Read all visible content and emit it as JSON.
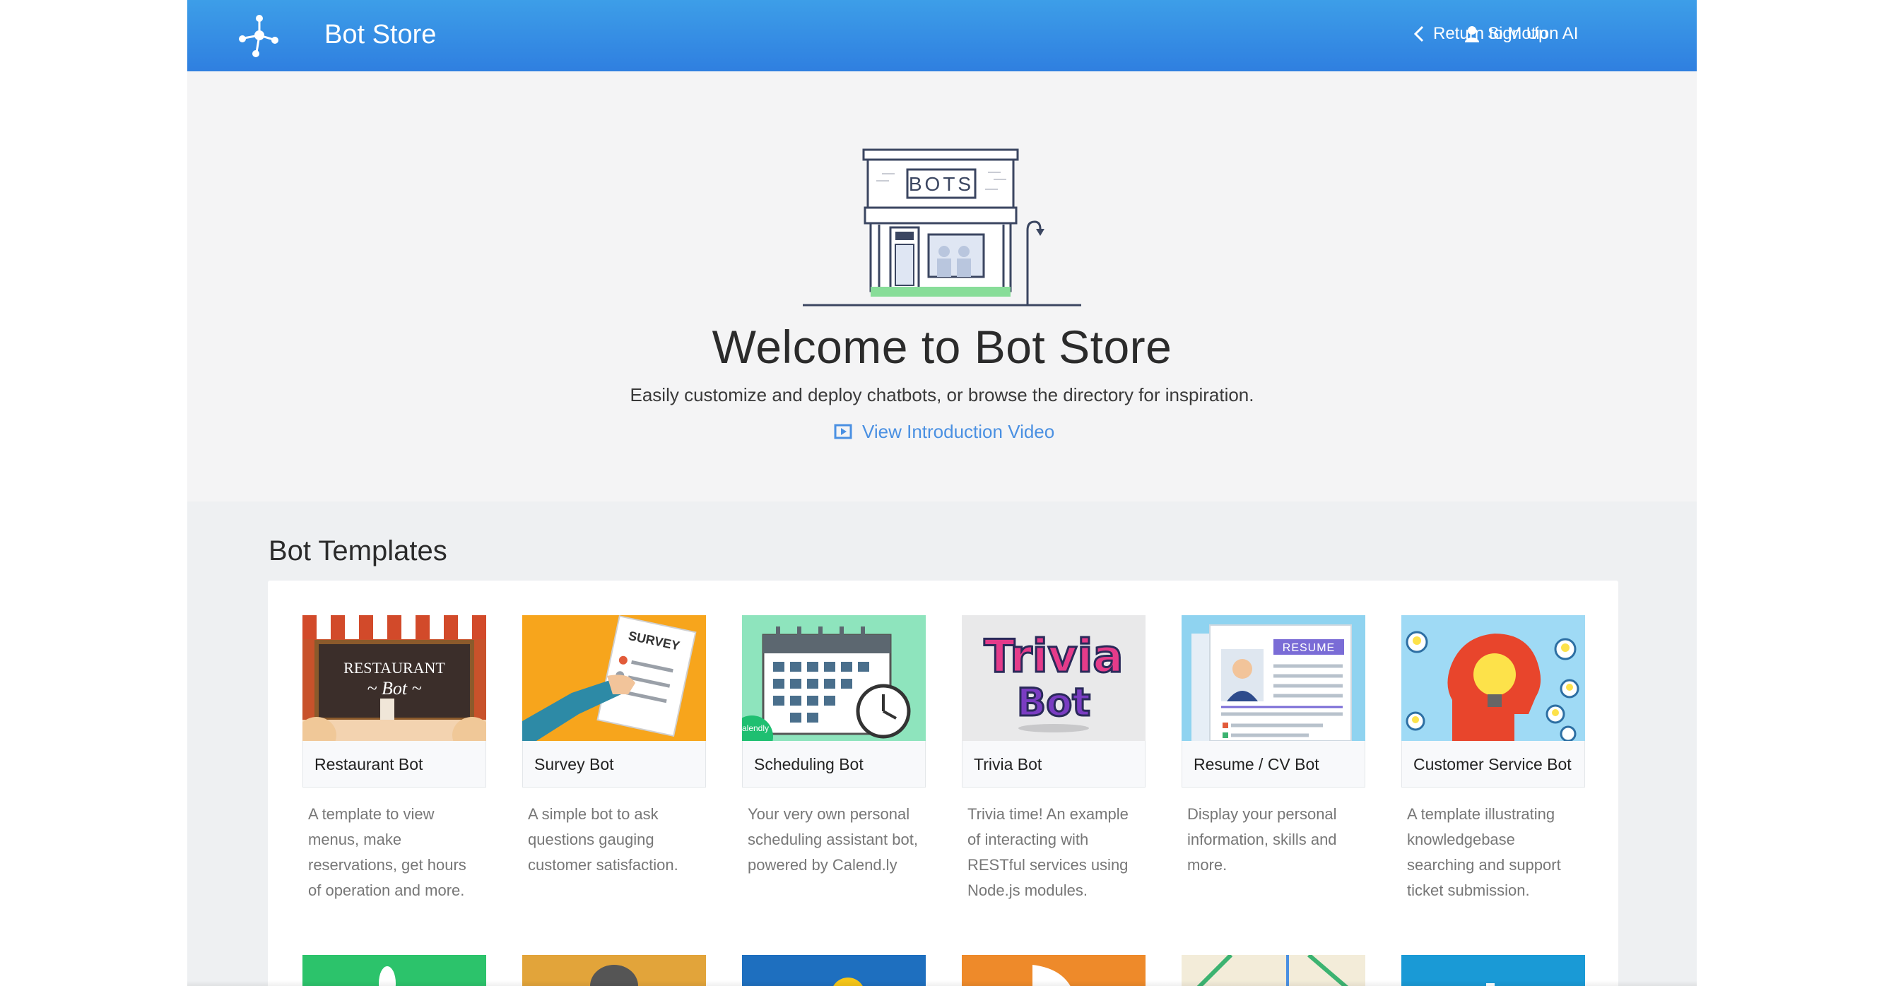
{
  "header": {
    "brand": "Bot Store",
    "return_link": "Return to Motion AI",
    "signup_link": "Sign Up"
  },
  "hero": {
    "sign_text": "BOTS",
    "title": "Welcome to Bot Store",
    "subtitle": "Easily customize and deploy chatbots, or browse the directory for inspiration.",
    "video_link": "View Introduction Video"
  },
  "templates": {
    "heading": "Bot Templates",
    "cards": [
      {
        "name": "Restaurant Bot",
        "desc": "A template to view menus, make reservations, get hours of operation and more.",
        "art_line1": "RESTAURANT",
        "art_line2": "~ Bot ~"
      },
      {
        "name": "Survey Bot",
        "desc": "A simple bot to ask questions gauging customer satisfaction.",
        "art_label": "SURVEY"
      },
      {
        "name": "Scheduling Bot",
        "desc": "Your very own personal scheduling assistant bot, powered by Calend.ly",
        "art_badge": "calendly"
      },
      {
        "name": "Trivia Bot",
        "desc": "Trivia time! An example of interacting with RESTful services using Node.js modules.",
        "art_line1": "Trivia",
        "art_line2": "Bot"
      },
      {
        "name": "Resume / CV Bot",
        "desc": "Display your personal information, skills and more.",
        "art_label": "RESUME"
      },
      {
        "name": "Customer Service Bot",
        "desc": "A template illustrating knowledgebase searching and support ticket submission."
      }
    ]
  },
  "colors": {
    "header_top": "#3d9ee8",
    "header_bottom": "#2f7fe0",
    "link": "#4a90e2"
  },
  "icons": [
    "network-logo-icon",
    "chevron-left-icon",
    "user-icon",
    "play-video-icon"
  ]
}
